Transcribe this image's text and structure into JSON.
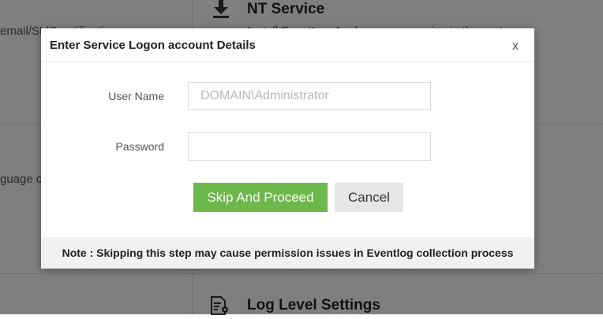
{
  "background": {
    "notification_text": "email/SMS notification",
    "nt_service": {
      "title": "NT Service",
      "description": "Install EventLog Analyzer as a service in the system.",
      "icon": "download-icon"
    },
    "language_text": "guage c",
    "log_level": {
      "title": "Log Level Settings",
      "icon": "document-settings-icon"
    }
  },
  "dialog": {
    "title": "Enter Service Logon account Details",
    "close_label": "x",
    "username": {
      "label": "User Name",
      "placeholder": "DOMAIN\\Administrator",
      "value": ""
    },
    "password": {
      "label": "Password",
      "value": ""
    },
    "primary_button": "Skip And Proceed",
    "cancel_button": "Cancel",
    "note": "Note : Skipping this step may cause permission issues in Eventlog collection process"
  },
  "colors": {
    "primary_button": "#6cb84b",
    "cancel_button": "#e6e6e6",
    "overlay": "rgba(0,0,0,0.5)"
  }
}
